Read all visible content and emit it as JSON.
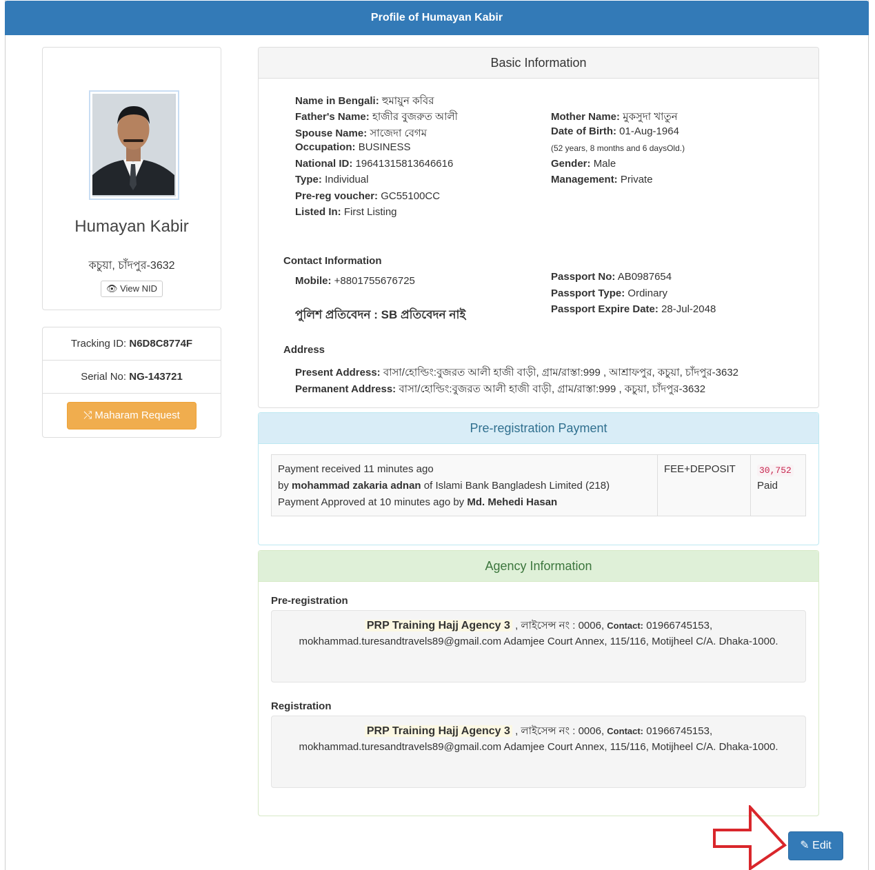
{
  "header": {
    "title": "Profile of Humayan Kabir"
  },
  "profile": {
    "name": "Humayan Kabir",
    "address": "কচুয়া, চাঁদপুর-3632",
    "view_nid_label": "View NID"
  },
  "ids": {
    "tracking_label": "Tracking ID:",
    "tracking_value": "N6D8C8774F",
    "serial_label": "Serial No:",
    "serial_value": "NG-143721",
    "maharam_label": "Maharam Request"
  },
  "basic": {
    "heading": "Basic Information",
    "left": [
      {
        "label": "Name in Bengali:",
        "value": "হুমায়ুন কবির"
      },
      {
        "label": "Father's Name:",
        "value": "হাজীর বুজরুত আলী"
      },
      {
        "label": "Spouse Name:",
        "value": "সাজেদা বেগম"
      },
      {
        "label": "Occupation:",
        "value": "BUSINESS"
      },
      {
        "label": "National ID:",
        "value": "19641315813646616"
      },
      {
        "label": "Type:",
        "value": "Individual"
      },
      {
        "label": "Pre-reg voucher:",
        "value": "GC55100CC"
      },
      {
        "label": "Listed In:",
        "value": "First Listing"
      }
    ],
    "right": {
      "mother_label": "Mother Name:",
      "mother_value": "মুকসুদা খাতুন",
      "dob_label": "Date of Birth:",
      "dob_value": "01-Aug-1964",
      "age_note": "(52 years, 8 months and 6 daysOld.)",
      "gender_label": "Gender:",
      "gender_value": "Male",
      "management_label": "Management:",
      "management_value": "Private"
    },
    "contact": {
      "title": "Contact Information",
      "mobile_label": "Mobile:",
      "mobile_value": "+8801755676725",
      "police_report": "পুলিশ প্রতিবেদন : SB প্রতিবেদন নাই",
      "passport_no_label": "Passport No:",
      "passport_no_value": "AB0987654",
      "passport_type_label": "Passport Type:",
      "passport_type_value": "Ordinary",
      "passport_expire_label": "Passport Expire Date:",
      "passport_expire_value": "28-Jul-2048"
    },
    "address": {
      "title": "Address",
      "present_label": "Present Address:",
      "present_value": "বাসা/হোল্ডিং:বুজরত আলী হাজী বাড়ী, গ্রাম/রাস্তা:999 , আশ্রাফপুর, কচুয়া, চাঁদপুর-3632",
      "permanent_label": "Permanent Address:",
      "permanent_value": "বাসা/হোল্ডিং:বুজরত আলী হাজী বাড়ী, গ্রাম/রাস্তা:999 , কচুয়া, চাঁদপুর-3632"
    }
  },
  "payment": {
    "heading": "Pre-registration Payment",
    "line1": "Payment received 11 minutes ago",
    "line2_by": "by",
    "line2_name": "mohammad zakaria adnan",
    "line2_rest": "of Islami Bank Bangladesh Limited (218)",
    "line3_prefix": "Payment Approved at 10 minutes ago by",
    "line3_name": "Md. Mehedi Hasan",
    "fee_type": "FEE+DEPOSIT",
    "amount": "30,752",
    "status": "Paid"
  },
  "agency": {
    "heading": "Agency Information",
    "prereg_title": "Pre-registration",
    "reg_title": "Registration",
    "name": "PRP Training Hajj Agency 3",
    "license": ", লাইসেন্স নং : 0006,",
    "contact_label": "Contact:",
    "contact_value": "01966745153,",
    "email_address": "mokhammad.turesandtravels89@gmail.com Adamjee Court Annex, 115/116, Motijheel C/A. Dhaka-1000."
  },
  "actions": {
    "edit_label": "Edit"
  },
  "colors": {
    "primary": "#337ab7",
    "warning": "#f0ad4e",
    "info_bg": "#d9edf7",
    "success_bg": "#dff0d8",
    "arrow": "#d9262b"
  },
  "icons": {
    "view_nid": "eye-icon",
    "maharam": "shuffle-icon",
    "edit": "edit-icon",
    "pointer": "arrow-icon"
  }
}
